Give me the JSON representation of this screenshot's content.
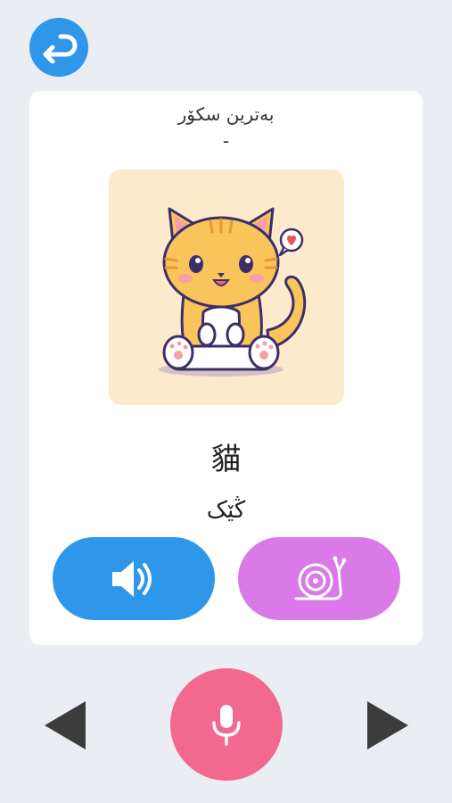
{
  "header": {
    "back_icon": "return-arrow-icon"
  },
  "card": {
    "best_score_label": "بەترین سکۆر",
    "best_score_value": "-",
    "image_subject": "cartoon-cat",
    "word": "貓",
    "transliteration": "ڭێک"
  },
  "actions": {
    "play_icon": "speaker-icon",
    "slow_icon": "snail-icon"
  },
  "bottom": {
    "prev_icon": "triangle-left-icon",
    "mic_icon": "microphone-icon",
    "next_icon": "triangle-right-icon"
  },
  "colors": {
    "background": "#eaeef3",
    "primary_blue": "#2f97ea",
    "slow_purple": "#d97ae8",
    "mic_pink": "#f2688f",
    "image_bg": "#fde9cc"
  }
}
